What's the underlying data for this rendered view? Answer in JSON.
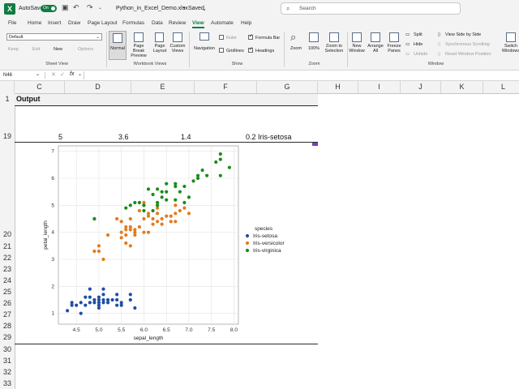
{
  "titlebar": {
    "autosave_label": "AutoSave",
    "autosave_state": "On",
    "filename": "Python_in_Excel_Demo.xlsx",
    "saved_status": "Saved",
    "search_placeholder": "Search"
  },
  "tabs": [
    "File",
    "Home",
    "Insert",
    "Draw",
    "Page Layout",
    "Formulas",
    "Data",
    "Review",
    "View",
    "Automate",
    "Help"
  ],
  "active_tab": "View",
  "ribbon": {
    "sheet_view": {
      "select_value": "Default",
      "keep": "Keep",
      "exit": "Exit",
      "new": "New",
      "options": "Options",
      "label": "Sheet View"
    },
    "workbook_views": {
      "normal": "Normal",
      "page_break": "Page Break Preview",
      "page_layout": "Page Layout",
      "custom_views": "Custom Views",
      "label": "Workbook Views"
    },
    "show": {
      "navigation": "Navigation",
      "ruler": "Ruler",
      "gridlines": "Gridlines",
      "formula_bar": "Formula Bar",
      "headings": "Headings",
      "label": "Show"
    },
    "zoom": {
      "zoom": "Zoom",
      "hundred": "100%",
      "zoom_sel": "Zoom to Selection",
      "label": "Zoom"
    },
    "window": {
      "new_window": "New Window",
      "arrange_all": "Arrange All",
      "freeze": "Freeze Panes",
      "split": "Split",
      "hide": "Hide",
      "unhide": "Unhide",
      "side_by_side": "View Side by Side",
      "sync_scroll": "Synchronous Scrolling",
      "reset_pos": "Reset Window Position",
      "switch": "Switch Windows",
      "label": "Window"
    }
  },
  "formula_bar": {
    "name_box": "N46",
    "fx": "fx",
    "content": ""
  },
  "columns": [
    "C",
    "D",
    "E",
    "F",
    "G",
    "H",
    "I",
    "J",
    "K",
    "L"
  ],
  "rows": [
    "1",
    "19",
    "20",
    "21",
    "22",
    "23",
    "24",
    "25",
    "26",
    "27",
    "28",
    "29",
    "30",
    "31",
    "32",
    "33"
  ],
  "cells": {
    "a1": "Output",
    "c19": "5",
    "d19": "3.6",
    "e19": "1.4",
    "f19": "0.2 Iris-setosa"
  },
  "chart_data": {
    "type": "scatter",
    "xlabel": "sepal_length",
    "ylabel": "petal_length",
    "xlim": [
      4.1,
      8.1
    ],
    "ylim": [
      0.6,
      7.2
    ],
    "x_ticks": [
      "4.5",
      "5.0",
      "5.5",
      "6.0",
      "6.5",
      "7.0",
      "7.5",
      "8.0"
    ],
    "y_ticks": [
      "1",
      "2",
      "3",
      "4",
      "5",
      "6",
      "7"
    ],
    "grid": true,
    "legend_title": "species",
    "legend_position": "right",
    "series": [
      {
        "name": "Iris-setosa",
        "color": "#1f4fa3",
        "points": [
          [
            4.3,
            1.1
          ],
          [
            4.4,
            1.3
          ],
          [
            4.4,
            1.4
          ],
          [
            4.5,
            1.3
          ],
          [
            4.6,
            1.0
          ],
          [
            4.6,
            1.4
          ],
          [
            4.7,
            1.3
          ],
          [
            4.7,
            1.6
          ],
          [
            4.8,
            1.4
          ],
          [
            4.8,
            1.6
          ],
          [
            4.8,
            1.9
          ],
          [
            4.9,
            1.4
          ],
          [
            4.9,
            1.5
          ],
          [
            5.0,
            1.2
          ],
          [
            5.0,
            1.3
          ],
          [
            5.0,
            1.4
          ],
          [
            5.0,
            1.5
          ],
          [
            5.0,
            1.6
          ],
          [
            5.1,
            1.4
          ],
          [
            5.1,
            1.5
          ],
          [
            5.1,
            1.7
          ],
          [
            5.1,
            1.9
          ],
          [
            5.2,
            1.4
          ],
          [
            5.2,
            1.5
          ],
          [
            5.3,
            1.5
          ],
          [
            5.4,
            1.3
          ],
          [
            5.4,
            1.5
          ],
          [
            5.4,
            1.7
          ],
          [
            5.5,
            1.3
          ],
          [
            5.5,
            1.4
          ],
          [
            5.7,
            1.5
          ],
          [
            5.7,
            1.7
          ],
          [
            5.8,
            1.2
          ]
        ]
      },
      {
        "name": "Iris-versicolor",
        "color": "#e37b1c",
        "points": [
          [
            4.9,
            3.3
          ],
          [
            4.9,
            4.5
          ],
          [
            5.0,
            3.3
          ],
          [
            5.0,
            3.5
          ],
          [
            5.1,
            3.0
          ],
          [
            5.2,
            3.9
          ],
          [
            5.4,
            4.5
          ],
          [
            5.5,
            3.8
          ],
          [
            5.5,
            4.0
          ],
          [
            5.5,
            4.4
          ],
          [
            5.6,
            3.6
          ],
          [
            5.6,
            3.9
          ],
          [
            5.6,
            4.1
          ],
          [
            5.6,
            4.2
          ],
          [
            5.7,
            3.5
          ],
          [
            5.7,
            4.1
          ],
          [
            5.7,
            4.2
          ],
          [
            5.7,
            4.5
          ],
          [
            5.8,
            3.9
          ],
          [
            5.8,
            4.0
          ],
          [
            5.8,
            4.1
          ],
          [
            5.9,
            4.2
          ],
          [
            5.9,
            4.8
          ],
          [
            6.0,
            4.0
          ],
          [
            6.0,
            4.5
          ],
          [
            6.0,
            5.1
          ],
          [
            6.1,
            4.0
          ],
          [
            6.1,
            4.6
          ],
          [
            6.1,
            4.7
          ],
          [
            6.2,
            4.3
          ],
          [
            6.2,
            4.5
          ],
          [
            6.3,
            4.4
          ],
          [
            6.3,
            4.7
          ],
          [
            6.3,
            4.9
          ],
          [
            6.4,
            4.3
          ],
          [
            6.4,
            4.5
          ],
          [
            6.5,
            4.6
          ],
          [
            6.6,
            4.4
          ],
          [
            6.6,
            4.6
          ],
          [
            6.7,
            4.4
          ],
          [
            6.7,
            4.7
          ],
          [
            6.7,
            5.0
          ],
          [
            6.8,
            4.8
          ],
          [
            6.9,
            4.9
          ],
          [
            7.0,
            4.7
          ]
        ]
      },
      {
        "name": "Iris-virginica",
        "color": "#1a8c1a",
        "points": [
          [
            4.9,
            4.5
          ],
          [
            5.6,
            4.9
          ],
          [
            5.7,
            5.0
          ],
          [
            5.8,
            5.1
          ],
          [
            5.9,
            5.1
          ],
          [
            6.0,
            5.0
          ],
          [
            6.0,
            4.8
          ],
          [
            6.1,
            5.6
          ],
          [
            6.2,
            4.8
          ],
          [
            6.2,
            5.4
          ],
          [
            6.3,
            5.0
          ],
          [
            6.3,
            5.6
          ],
          [
            6.3,
            5.1
          ],
          [
            6.4,
            5.3
          ],
          [
            6.4,
            5.5
          ],
          [
            6.5,
            5.2
          ],
          [
            6.5,
            5.5
          ],
          [
            6.5,
            5.8
          ],
          [
            6.7,
            5.2
          ],
          [
            6.7,
            5.7
          ],
          [
            6.7,
            5.8
          ],
          [
            6.8,
            5.5
          ],
          [
            6.9,
            5.1
          ],
          [
            6.9,
            5.7
          ],
          [
            7.0,
            5.3
          ],
          [
            7.1,
            5.9
          ],
          [
            7.2,
            6.0
          ],
          [
            7.2,
            6.1
          ],
          [
            7.3,
            6.3
          ],
          [
            7.4,
            6.1
          ],
          [
            7.6,
            6.6
          ],
          [
            7.7,
            6.1
          ],
          [
            7.7,
            6.7
          ],
          [
            7.7,
            6.9
          ],
          [
            7.9,
            6.4
          ]
        ]
      }
    ]
  }
}
